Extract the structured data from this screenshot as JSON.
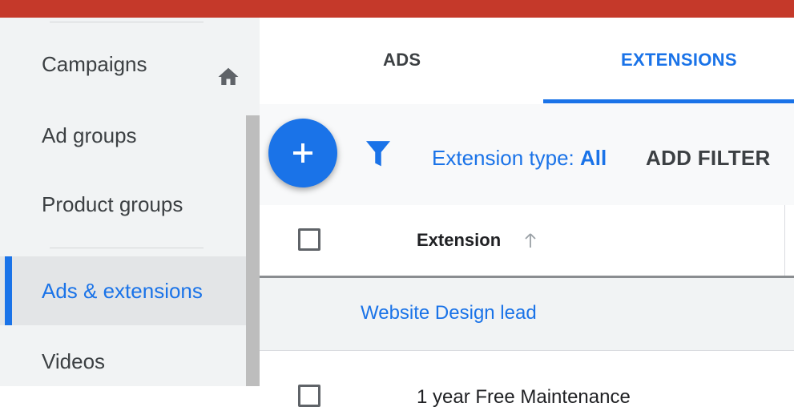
{
  "colors": {
    "accent": "#1a73e8",
    "topbar": "#c5392a",
    "sidebar_bg": "#f1f3f4",
    "text": "#3c4043"
  },
  "sidebar": {
    "items": [
      {
        "label": "Campaigns",
        "icon": "home-icon",
        "active": false
      },
      {
        "label": "Ad groups",
        "active": false
      },
      {
        "label": "Product groups",
        "active": false
      },
      {
        "label": "Ads & extensions",
        "active": true
      },
      {
        "label": "Videos",
        "active": false
      }
    ]
  },
  "tabs": [
    {
      "label": "ADS",
      "active": false
    },
    {
      "label": "EXTENSIONS",
      "active": true
    }
  ],
  "toolbar": {
    "add_icon": "plus-icon",
    "filter_icon": "filter-icon",
    "extension_type_label": "Extension type:",
    "extension_type_value": "All",
    "add_filter_label": "ADD FILTER"
  },
  "table": {
    "columns": [
      {
        "label": "Extension",
        "sort": "ascending",
        "sort_icon": "arrow-up-icon"
      }
    ],
    "group_label": "Website Design lead",
    "rows": [
      {
        "extension": "1 year Free Maintenance"
      }
    ]
  }
}
